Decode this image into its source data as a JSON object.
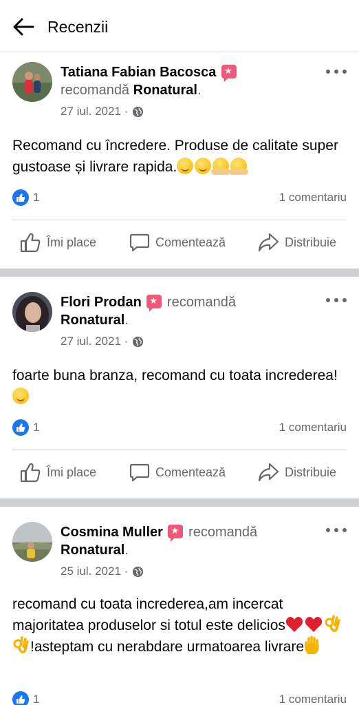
{
  "header": {
    "title": "Recenzii",
    "back_icon": "arrow-left-icon"
  },
  "posts": [
    {
      "author": "Tatiana Fabian Bacosca",
      "verb": "recomandă",
      "page": "Ronatural",
      "date": "27 iul. 2021 ·",
      "text": "Recomand cu încredere. Produse de calitate super gustoase și livrare rapida.",
      "emojis": [
        "smiling-face",
        "smiling-face",
        "hugging-face",
        "hugging-face"
      ],
      "likes": "1",
      "comments": "1 comentariu",
      "actions": {
        "like": "Îmi place",
        "comment": "Comentează",
        "share": "Distribuie"
      }
    },
    {
      "author": "Flori Prodan",
      "verb": "recomandă",
      "page": "Ronatural",
      "date": "27 iul. 2021 ·",
      "text": "foarte buna branza, recomand cu toata increderea!",
      "emojis": [
        "smiling-face"
      ],
      "likes": "1",
      "comments": "1 comentariu",
      "actions": {
        "like": "Îmi place",
        "comment": "Comentează",
        "share": "Distribuie"
      }
    },
    {
      "author": "Cosmina Muller",
      "verb": "recomandă",
      "page": "Ronatural",
      "date": "25 iul. 2021 ·",
      "text_a": "recomand cu toata increderea,am incercat majoritatea produselor si totul este delicios",
      "text_b": "!asteptam cu nerabdare urmatoarea livrare",
      "emojis": [
        "red-heart",
        "red-heart",
        "ok-hand",
        "ok-hand",
        "raised-hand"
      ],
      "likes": "1",
      "comments": "1 comentariu"
    }
  ],
  "colors": {
    "accent": "#1877f2",
    "badge": "#f0587a",
    "secondary_text": "#65676b",
    "separator": "#ced0d4"
  }
}
